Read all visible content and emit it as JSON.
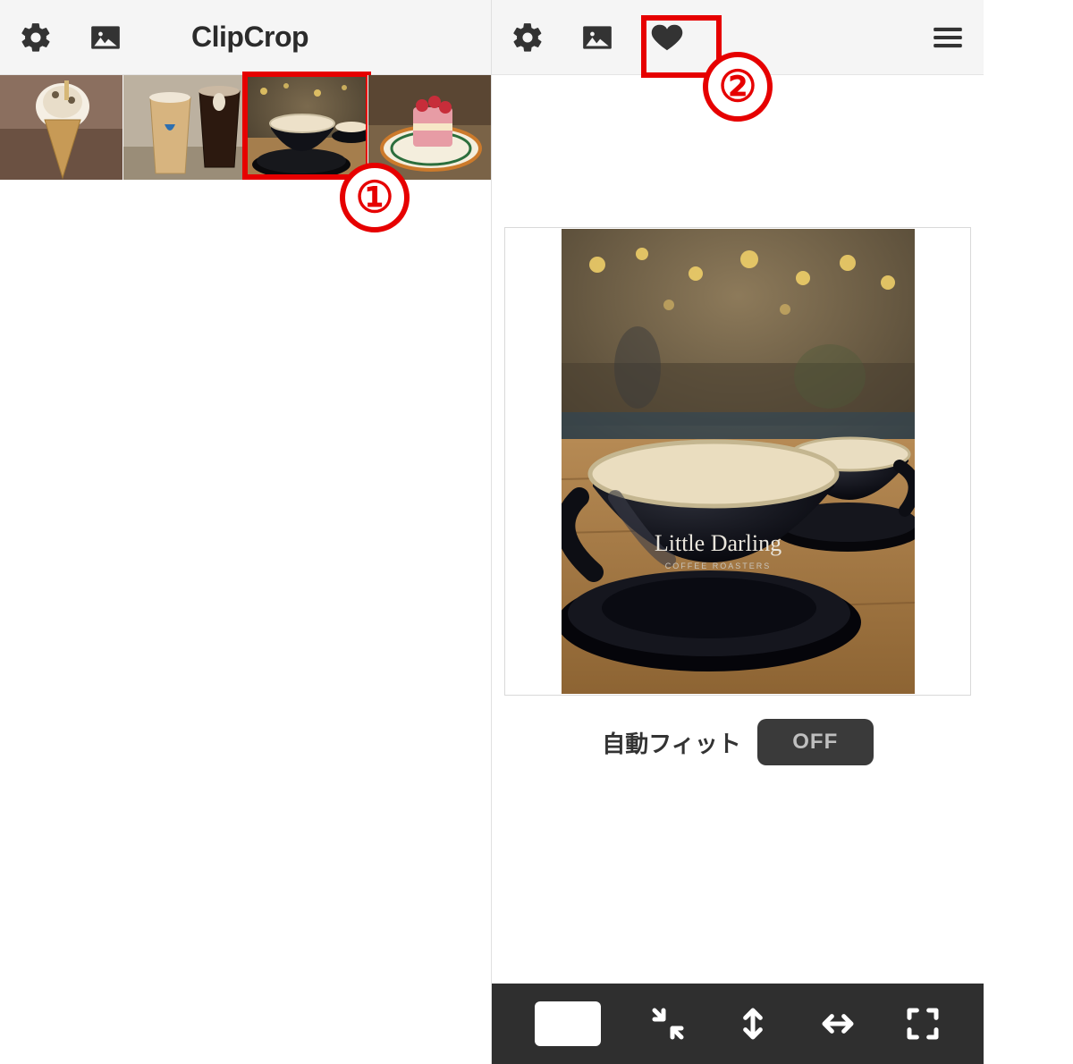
{
  "left": {
    "header": {
      "title": "ClipCrop",
      "settings_icon": "gear",
      "gallery_icon": "image"
    },
    "thumbs": [
      {
        "alt": "soft-serve-cone"
      },
      {
        "alt": "iced-coffee-cups"
      },
      {
        "alt": "black-latte-cup",
        "selected": true
      },
      {
        "alt": "strawberry-cake"
      }
    ]
  },
  "right": {
    "header": {
      "settings_icon": "gear",
      "gallery_icon": "image",
      "favorite_icon": "heart",
      "menu_icon": "menu"
    },
    "preview_alt": "black-latte-cup-large",
    "preview_cup_label": "Little Darling",
    "preview_cup_sub": "COFFEE ROASTERS",
    "fit": {
      "label": "自動フィット",
      "value": "OFF"
    },
    "toolbar": {
      "aspect_icon": "white-rect",
      "shrink_icon": "arrows-in",
      "vflip_icon": "arrows-vertical",
      "hflip_icon": "arrows-horizontal",
      "expand_icon": "corners-out"
    }
  },
  "annotations": {
    "badge1": "①",
    "badge2": "②"
  },
  "colors": {
    "accent_red": "#e60000",
    "toolbar_bg": "#2f2f2f"
  }
}
